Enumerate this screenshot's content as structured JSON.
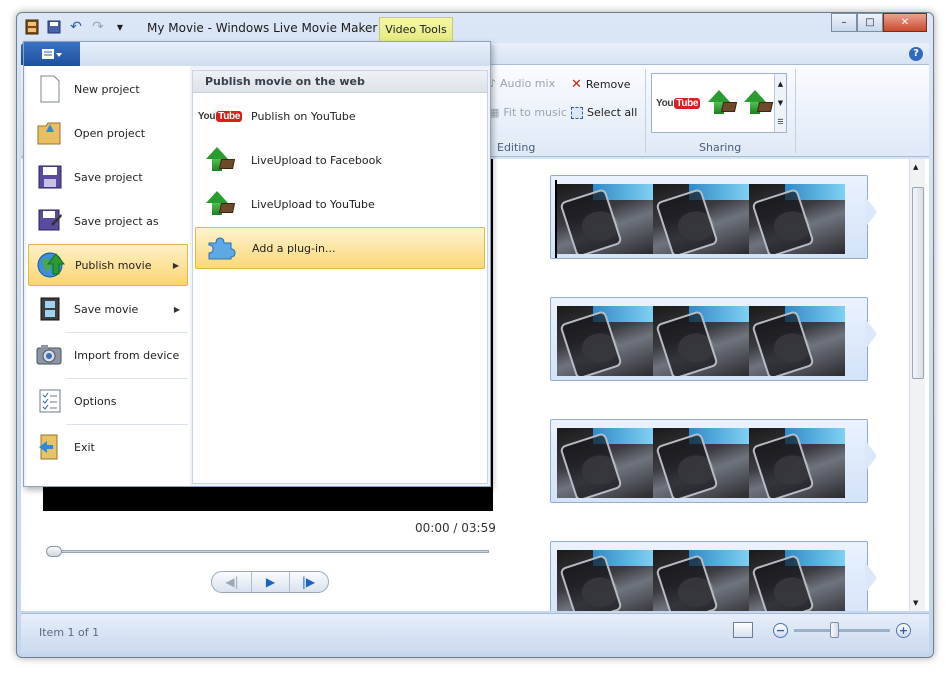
{
  "window": {
    "title": "My Movie - Windows Live Movie Maker",
    "context_tab": "Video Tools",
    "controls": {
      "minimize": "–",
      "maximize": "□",
      "close": "✕"
    }
  },
  "ribbon": {
    "help_label": "?",
    "editing": {
      "audio_mix": "Audio mix",
      "fit_to_music": "Fit to music",
      "remove": "Remove",
      "select_all": "Select all",
      "group_label": "Editing"
    },
    "sharing": {
      "group_label": "Sharing",
      "gallery": [
        "youtube-icon",
        "liveupload-facebook-icon",
        "liveupload-youtube-icon"
      ]
    }
  },
  "app_menu": {
    "items": [
      {
        "label": "New project",
        "icon": "new-project-icon"
      },
      {
        "label": "Open project",
        "icon": "open-project-icon"
      },
      {
        "label": "Save project",
        "icon": "save-project-icon"
      },
      {
        "label": "Save project as",
        "icon": "save-project-as-icon"
      },
      {
        "label": "Publish movie",
        "icon": "publish-movie-icon",
        "submenu": true,
        "active": true
      },
      {
        "label": "Save movie",
        "icon": "save-movie-icon",
        "submenu": true
      },
      {
        "label": "Import from device",
        "icon": "import-device-icon"
      },
      {
        "label": "Options",
        "icon": "options-icon"
      },
      {
        "label": "Exit",
        "icon": "exit-icon"
      }
    ],
    "submenu": {
      "header": "Publish movie on the web",
      "items": [
        {
          "label": "Publish on YouTube",
          "icon": "youtube-icon"
        },
        {
          "label": "LiveUpload to Facebook",
          "icon": "liveupload-icon"
        },
        {
          "label": "LiveUpload to YouTube",
          "icon": "liveupload-icon"
        },
        {
          "label": "Add a plug-in...",
          "icon": "puzzle-icon",
          "active": true
        }
      ]
    }
  },
  "preview": {
    "time_current": "00:00",
    "time_total": "03:59",
    "time_display": "00:00 / 03:59",
    "seek_position": 0
  },
  "storyboard": {
    "clips": 4,
    "frames_per_clip": 3
  },
  "status": {
    "item_text": "Item 1 of 1",
    "zoom_minus": "−",
    "zoom_plus": "+"
  }
}
